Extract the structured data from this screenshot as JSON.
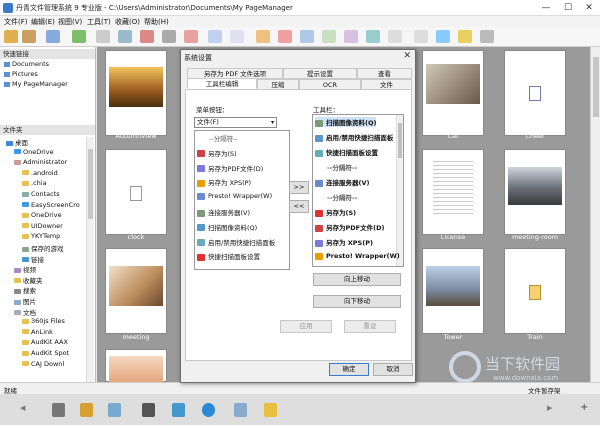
{
  "window": {
    "title": "丹青文件管理系统 9 专业版 - C:\\Users\\Administrator\\Documents\\My PageManager",
    "min": "—",
    "max": "☐",
    "close": "✕"
  },
  "menu": [
    {
      "label": "文件(F)"
    },
    {
      "label": "编辑(E)"
    },
    {
      "label": "视图(V)"
    },
    {
      "label": "工具(T)"
    },
    {
      "label": "收藏(O)"
    },
    {
      "label": "帮助(H)"
    }
  ],
  "left": {
    "quick_header": "快速链接",
    "quick": [
      "Documents",
      "Pictures",
      "My PageManager"
    ],
    "folder_header": "文件夹",
    "tree": [
      "桌面",
      "OneDrive",
      "Administrator",
      ".android",
      ".chia",
      "Contacts",
      "EasyScreenCro",
      "OneDrive",
      "UIDowner",
      "YKYTemp",
      "保存的游戏",
      "链接",
      "视频",
      "收藏夹",
      "搜索",
      "图片",
      "文档",
      "360js Files",
      "AnLink",
      "AudKit AAX",
      "AudKit Spot",
      "CAJ Downl"
    ]
  },
  "gallery": {
    "items": [
      {
        "caption": "AutumnView"
      },
      {
        "caption": "Cat"
      },
      {
        "caption": "Cheer"
      },
      {
        "caption": "clock"
      },
      {
        "caption": "License"
      },
      {
        "caption": "meeting-room"
      },
      {
        "caption": "meeting"
      },
      {
        "caption": "Tower"
      },
      {
        "caption": "Train"
      }
    ]
  },
  "dialog": {
    "title": "系统设置",
    "close": "✕",
    "tabs_row1": [
      "另存为 PDF 文件选项",
      "提示设置",
      "查看"
    ],
    "tabs_row2": [
      "工具栏编辑",
      "压缩",
      "OCR",
      "文件"
    ],
    "menu_label": "菜单按钮：",
    "toolbar_label": "工具栏：",
    "combo_value": "文件(F)",
    "combo_arrow": "▾",
    "left_list": [
      "--分隔符--",
      "另存为(S)",
      "另存为PDF文件(D)",
      "另存为 XPS(P)",
      "Presto! Wrapper(W)",
      "连接服务器(V)",
      "扫描图像资料(Q)",
      "启用/禁用快捷扫描面板",
      "快捷扫描面板设置"
    ],
    "right_list": [
      "扫描图像资料(Q)",
      "启用/禁用快捷扫描面板",
      "快捷扫描面板设置",
      "--分隔符--",
      "连接服务器(V)",
      "--分隔符--",
      "另存为(S)",
      "另存为PDF文件(D)",
      "另存为 XPS(P)",
      "Presto! Wrapper(W)"
    ],
    "add": ">>",
    "remove": "<<",
    "move_up": "向上移动",
    "move_down": "向下移动",
    "apply": "应用",
    "reset": "重设",
    "ok": "确定",
    "cancel": "取消"
  },
  "status": {
    "left": "就绪",
    "right": "文件暂存架"
  },
  "bottom": {
    "left_arrow": "◀",
    "right_arrow": "▶",
    "plus": "+"
  },
  "watermark": {
    "title": "当下软件园",
    "url": "www.downxia.com"
  }
}
